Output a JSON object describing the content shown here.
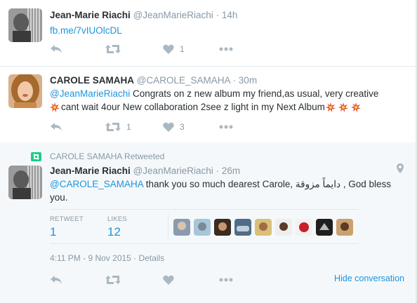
{
  "tweets": [
    {
      "fullname": "Jean-Marie Riachi",
      "handle": "@JeanMarieRiachi",
      "dot": "·",
      "time": "14h",
      "link": "fb.me/7vIUOlcDL",
      "like_count": "1"
    },
    {
      "fullname": "CAROLE SAMAHA",
      "handle": "@CAROLE_SAMAHA",
      "dot": "·",
      "time": "30m",
      "mention": "@JeanMarieRiachi",
      "text_line1": " Congrats on z new album my friend,as usual, very creative",
      "text_line2": "cant wait 4our New collaboration 2see z light in my Next Album",
      "retweet_count": "1",
      "like_count": "3"
    }
  ],
  "expanded": {
    "context": "CAROLE SAMAHA Retweeted",
    "fullname": "Jean-Marie Riachi",
    "handle": "@JeanMarieRiachi",
    "dot": "·",
    "time": "26m",
    "mention": "@CAROLE_SAMAHA",
    "text_before": " thank you so much dearest Carole, ",
    "arabic": "دايماً مزوقة",
    "text_after": " , God bless",
    "text_line2": "you.",
    "retweet_label": "RETWEET",
    "retweet_value": "1",
    "likes_label": "LIKES",
    "likes_value": "12",
    "timestamp": "4:11 PM - 9 Nov 2015",
    "dot2": "·",
    "details": "Details",
    "hide_conversation": "Hide conversation"
  },
  "colors": {
    "link_blue": "#1b95e0",
    "muted": "#8899a6",
    "icon": "#aab8c2",
    "retweet_green": "#19cf86"
  },
  "icons": [
    "reply-icon",
    "retweet-icon",
    "like-heart-icon",
    "more-dots-icon",
    "location-pin-icon",
    "starburst-emoji"
  ]
}
